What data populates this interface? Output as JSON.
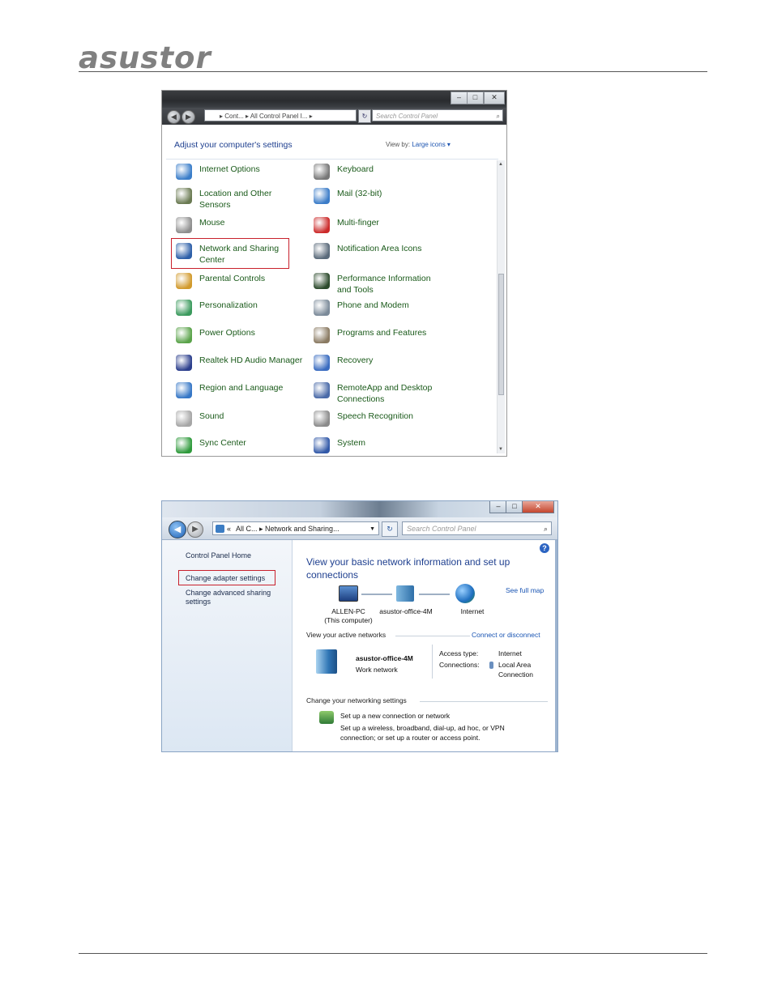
{
  "header": {
    "logo_text": "asustor"
  },
  "control_panel": {
    "nav_back_icon": "back-arrow-icon",
    "address": "▸ Cont... ▸ All Control Panel I... ▸",
    "search_placeholder": "Search Control Panel",
    "heading": "Adjust your computer's settings",
    "view_by_label": "View by:",
    "view_by_value": "Large icons ▾",
    "left_items": [
      {
        "label": "Internet Options",
        "icon": "internet-options-icon",
        "color": "#3a7dc9"
      },
      {
        "label": "Location and Other Sensors",
        "icon": "location-sensors-icon",
        "color": "#6a7a52"
      },
      {
        "label": "Mouse",
        "icon": "mouse-icon",
        "color": "#8e8e8e"
      },
      {
        "label": "Network and Sharing Center",
        "icon": "network-sharing-icon",
        "color": "#2d5fa8"
      },
      {
        "label": "Parental Controls",
        "icon": "parental-controls-icon",
        "color": "#d19a2c"
      },
      {
        "label": "Personalization",
        "icon": "personalization-icon",
        "color": "#3b9a5d"
      },
      {
        "label": "Power Options",
        "icon": "power-options-icon",
        "color": "#5aa34a"
      },
      {
        "label": "Realtek HD Audio Manager",
        "icon": "audio-manager-icon",
        "color": "#2b3e8c"
      },
      {
        "label": "Region and Language",
        "icon": "region-language-icon",
        "color": "#3677c6"
      },
      {
        "label": "Sound",
        "icon": "sound-icon",
        "color": "#a6a6a6"
      },
      {
        "label": "Sync Center",
        "icon": "sync-center-icon",
        "color": "#2f9a3c"
      }
    ],
    "right_items": [
      {
        "label": "Keyboard",
        "icon": "keyboard-icon",
        "color": "#777777"
      },
      {
        "label": "Mail (32-bit)",
        "icon": "mail-icon",
        "color": "#3b7cc8"
      },
      {
        "label": "Multi-finger",
        "icon": "multi-finger-icon",
        "color": "#cc2a2a"
      },
      {
        "label": "Notification Area Icons",
        "icon": "notification-area-icon",
        "color": "#5a6a7a"
      },
      {
        "label": "Performance Information and Tools",
        "icon": "performance-icon",
        "color": "#2c4a2c"
      },
      {
        "label": "Phone and Modem",
        "icon": "phone-modem-icon",
        "color": "#7b8a99"
      },
      {
        "label": "Programs and Features",
        "icon": "programs-features-icon",
        "color": "#8a7a62"
      },
      {
        "label": "Recovery",
        "icon": "recovery-icon",
        "color": "#3a6cc0"
      },
      {
        "label": "RemoteApp and Desktop Connections",
        "icon": "remoteapp-icon",
        "color": "#4a6aa8"
      },
      {
        "label": "Speech Recognition",
        "icon": "speech-recognition-icon",
        "color": "#8a8a8a"
      },
      {
        "label": "System",
        "icon": "system-icon",
        "color": "#3259a8"
      }
    ]
  },
  "network_center": {
    "address_prefix": "«",
    "address": "All C... ▸ Network and Sharing...",
    "search_placeholder": "Search Control Panel",
    "left_links": {
      "home": "Control Panel Home",
      "adapter": "Change adapter settings",
      "advanced_1": "Change advanced sharing",
      "advanced_2": "settings"
    },
    "heading": "View your basic network information and set up connections",
    "see_full_map": "See full map",
    "map": {
      "computer": "ALLEN-PC",
      "computer_sub": "(This computer)",
      "network": "asustor-office-4M",
      "internet": "Internet"
    },
    "active_networks_label": "View your active networks",
    "connect_disconnect": "Connect or disconnect",
    "active_network": {
      "name": "asustor-office-4M",
      "type": "Work network",
      "access_type_label": "Access type:",
      "access_type_value": "Internet",
      "connections_label": "Connections:",
      "connections_value_1": "Local Area",
      "connections_value_2": "Connection"
    },
    "change_settings_label": "Change your networking settings",
    "setup": {
      "title": "Set up a new connection or network",
      "desc_1": "Set up a wireless, broadband, dial-up, ad hoc, or VPN",
      "desc_2": "connection; or set up a router or access point."
    }
  }
}
